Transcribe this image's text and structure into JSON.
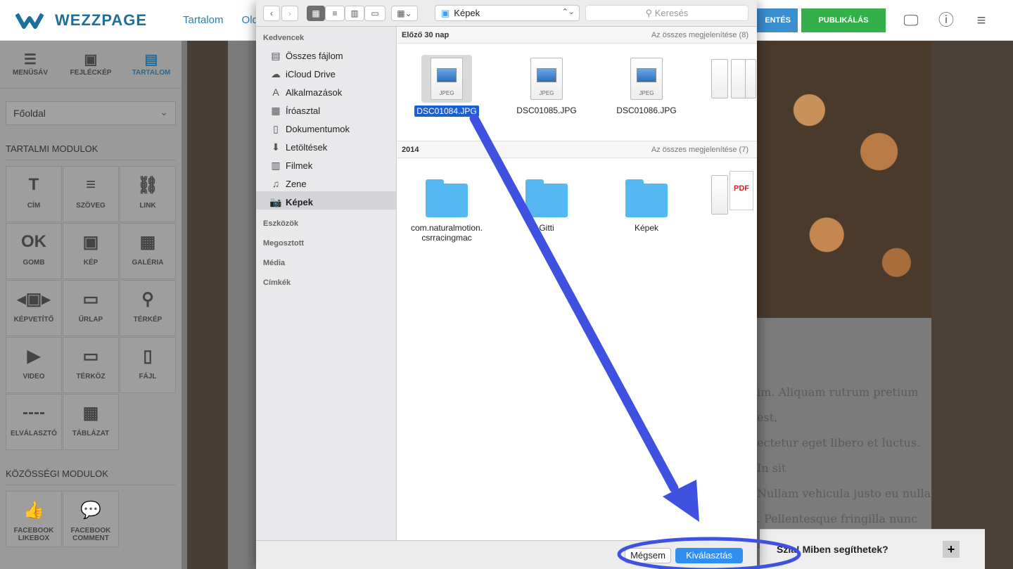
{
  "app": {
    "logo_text": "WEZZPAGE",
    "nav": [
      "Tartalom",
      "Old"
    ],
    "save_label": "ENTÉS",
    "publish_label": "PUBLIKÁLÁS"
  },
  "sidebar": {
    "tabs": [
      {
        "label": "MENÜSÁV",
        "icon": "menu-icon"
      },
      {
        "label": "FEJLÉCKÉP",
        "icon": "image-icon"
      },
      {
        "label": "TARTALOM",
        "icon": "document-icon"
      }
    ],
    "page_select": "Főoldal",
    "content_modules_title": "TARTALMI MODULOK",
    "modules": [
      {
        "label": "CÍM",
        "icon": "title-icon",
        "glyph": "T"
      },
      {
        "label": "SZÖVEG",
        "icon": "text-icon",
        "glyph": "≡"
      },
      {
        "label": "LINK",
        "icon": "link-icon",
        "glyph": "⛓"
      },
      {
        "label": "GOMB",
        "icon": "button-icon",
        "glyph": "OK"
      },
      {
        "label": "KÉP",
        "icon": "image-icon",
        "glyph": "▣"
      },
      {
        "label": "GALÉRIA",
        "icon": "gallery-icon",
        "glyph": "▦"
      },
      {
        "label": "KÉPVETÍTŐ",
        "icon": "slideshow-icon",
        "glyph": "◂▣▸"
      },
      {
        "label": "ŰRLAP",
        "icon": "form-icon",
        "glyph": "▭"
      },
      {
        "label": "TÉRKÉP",
        "icon": "map-pin-icon",
        "glyph": "⚲"
      },
      {
        "label": "VIDEO",
        "icon": "video-icon",
        "glyph": "▶"
      },
      {
        "label": "TÉRKÖZ",
        "icon": "spacer-icon",
        "glyph": "▭"
      },
      {
        "label": "FÁJL",
        "icon": "file-icon",
        "glyph": "▯"
      },
      {
        "label": "ELVÁLASZTÓ",
        "icon": "divider-icon",
        "glyph": "----"
      },
      {
        "label": "TÁBLÁZAT",
        "icon": "table-icon",
        "glyph": "▦"
      }
    ],
    "social_modules_title": "KÖZÖSSÉGI MODULOK",
    "social": [
      {
        "label": "FACEBOOK LIKEBOX",
        "icon": "thumbs-up-icon",
        "glyph": "👍"
      },
      {
        "label": "FACEBOOK COMMENT",
        "icon": "comment-icon",
        "glyph": "💬"
      }
    ]
  },
  "page": {
    "lorem": [
      "im. Aliquam rutrum pretium est,",
      "ectetur eget libero et luctus. In sit",
      "Nullam vehicula justo eu nulla",
      ". Pellentesque fringilla nunc nec"
    ],
    "chat_text": "Miben segíthetek?",
    "chat_prefix": "Szia!"
  },
  "dialog": {
    "location": "Képek",
    "search_placeholder": "Keresés",
    "favorites_title": "Kedvencek",
    "favorites": [
      {
        "label": "Összes fájlom",
        "icon": "all-files-icon",
        "glyph": "▤"
      },
      {
        "label": "iCloud Drive",
        "icon": "cloud-icon",
        "glyph": "☁"
      },
      {
        "label": "Alkalmazások",
        "icon": "applications-icon",
        "glyph": "A"
      },
      {
        "label": "Íróasztal",
        "icon": "desktop-icon",
        "glyph": "▦"
      },
      {
        "label": "Dokumentumok",
        "icon": "documents-icon",
        "glyph": "▯"
      },
      {
        "label": "Letöltések",
        "icon": "downloads-icon",
        "glyph": "⬇"
      },
      {
        "label": "Filmek",
        "icon": "movies-icon",
        "glyph": "▥"
      },
      {
        "label": "Zene",
        "icon": "music-icon",
        "glyph": "♫"
      },
      {
        "label": "Képek",
        "icon": "camera-icon",
        "glyph": "📷",
        "selected": true
      }
    ],
    "other_sections": [
      "Eszközök",
      "Megosztott",
      "Média",
      "Címkék"
    ],
    "group1": {
      "title": "Előző 30 nap",
      "show_all": "Az összes megjelenítése (8)",
      "files": [
        {
          "name": "DSC01084.JPG",
          "selected": true
        },
        {
          "name": "DSC01085.JPG"
        },
        {
          "name": "DSC01086.JPG"
        }
      ]
    },
    "group2": {
      "title": "2014",
      "show_all": "Az összes megjelenítése (7)",
      "folders": [
        {
          "name": "com.naturalmotion.\ncsrracingmac"
        },
        {
          "name": "Gitti"
        },
        {
          "name": "Képek"
        }
      ]
    },
    "jpeg_label": "JPEG",
    "cancel_label": "Mégsem",
    "choose_label": "Kiválasztás"
  },
  "colors": {
    "annotation": "#3f51e0",
    "primary": "#2f8ef0",
    "publish": "#34b04a"
  }
}
